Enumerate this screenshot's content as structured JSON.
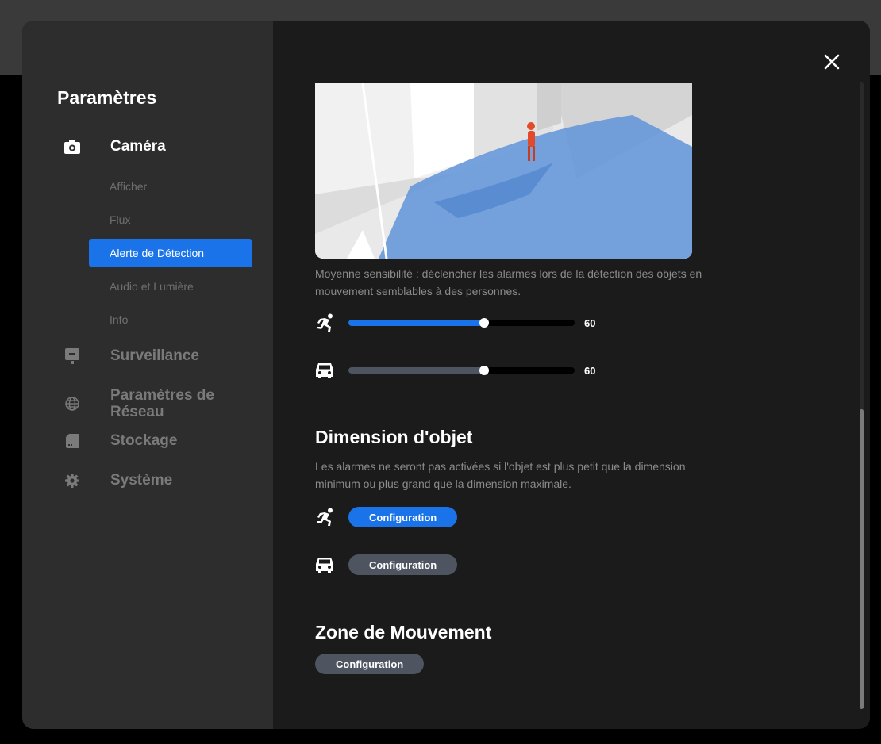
{
  "sidebar": {
    "title": "Paramètres",
    "nav": [
      {
        "label": "Caméra",
        "icon": "camera-icon"
      },
      {
        "label": "Surveillance",
        "icon": "monitor-icon"
      },
      {
        "label": "Paramètres de Réseau",
        "icon": "globe-icon"
      },
      {
        "label": "Stockage",
        "icon": "storage-icon"
      },
      {
        "label": "Système",
        "icon": "gear-icon"
      }
    ],
    "camera_sub": [
      {
        "label": "Afficher"
      },
      {
        "label": "Flux"
      },
      {
        "label": "Alerte de Détection",
        "active": true
      },
      {
        "label": "Audio et Lumière"
      },
      {
        "label": "Info"
      }
    ]
  },
  "content": {
    "close_icon": "close-icon",
    "sensitivity": {
      "description": "Moyenne sensibilité : déclencher les alarmes lors de la détection des objets en mouvement semblables à des personnes.",
      "person": {
        "icon": "running-person-icon",
        "value": 60,
        "value_label": "60"
      },
      "vehicle": {
        "icon": "car-icon",
        "value": 60,
        "value_label": "60"
      }
    },
    "object_size": {
      "title": "Dimension d'objet",
      "description": "Les alarmes ne seront pas activées si l'objet est plus petit que la dimension minimum ou plus grand que la dimension maximale.",
      "person_button": "Configuration",
      "vehicle_button": "Configuration"
    },
    "motion_zone": {
      "title": "Zone de Mouvement",
      "button": "Configuration"
    }
  },
  "colors": {
    "accent": "#1a73e8",
    "inactive_pill": "#4f5560",
    "sidebar_bg": "#2d2d2d",
    "content_bg": "#1b1b1b"
  }
}
